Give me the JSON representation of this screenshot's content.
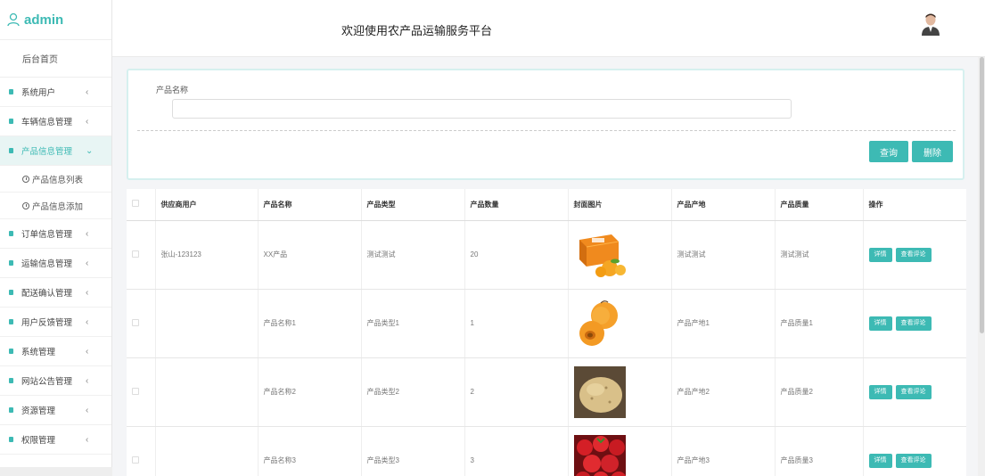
{
  "brand": {
    "name": "admin"
  },
  "header": {
    "title": "欢迎使用农产品运输服务平台"
  },
  "sidebar": {
    "home": "后台首页",
    "items": [
      {
        "label": "系统用户",
        "arrow": "‹"
      },
      {
        "label": "车辆信息管理",
        "arrow": "‹"
      },
      {
        "label": "产品信息管理",
        "arrow": "⌄",
        "active": true
      },
      {
        "label": "订单信息管理",
        "arrow": "‹"
      },
      {
        "label": "运输信息管理",
        "arrow": "‹"
      },
      {
        "label": "配送确认管理",
        "arrow": "‹"
      },
      {
        "label": "用户反馈管理",
        "arrow": "‹"
      },
      {
        "label": "系统管理",
        "arrow": "‹"
      },
      {
        "label": "网站公告管理",
        "arrow": "‹"
      },
      {
        "label": "资源管理",
        "arrow": "‹"
      },
      {
        "label": "权限管理",
        "arrow": "‹"
      }
    ],
    "sub_items": [
      "产品信息列表",
      "产品信息添加"
    ]
  },
  "search": {
    "label": "产品名称",
    "value": "",
    "query_button": "查询",
    "delete_button": "删除"
  },
  "table": {
    "headers": [
      "供应商用户",
      "产品名称",
      "产品类型",
      "产品数量",
      "封面图片",
      "产品产地",
      "产品质量",
      "操作"
    ],
    "detail_label": "详情",
    "review_label": "查看评论",
    "rows": [
      {
        "supplier": "张山-123123",
        "name": "XX产品",
        "type": "测试测试",
        "quantity": "20",
        "image": "orange-box",
        "origin": "测试测试",
        "quality": "测试测试"
      },
      {
        "supplier": "",
        "name": "产品名称1",
        "type": "产品类型1",
        "quantity": "1",
        "image": "apricot",
        "origin": "产品产地1",
        "quality": "产品质量1"
      },
      {
        "supplier": "",
        "name": "产品名称2",
        "type": "产品类型2",
        "quantity": "2",
        "image": "potato",
        "origin": "产品产地2",
        "quality": "产品质量2"
      },
      {
        "supplier": "",
        "name": "产品名称3",
        "type": "产品类型3",
        "quantity": "3",
        "image": "strawberry",
        "origin": "产品产地3",
        "quality": "产品质量3"
      }
    ]
  },
  "colors": {
    "accent": "#3dbab4"
  }
}
